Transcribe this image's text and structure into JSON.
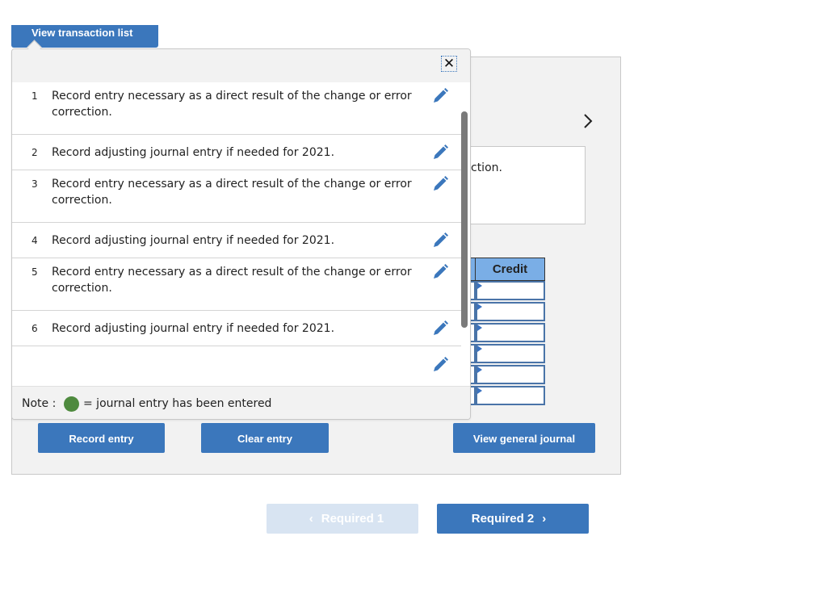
{
  "tab": {
    "view_transaction_list": "View transaction list"
  },
  "popover": {
    "close_label": "✕",
    "transactions": [
      {
        "number": "1",
        "text": "Record entry necessary as a direct result of the change or error correction."
      },
      {
        "number": "2",
        "text": "Record adjusting journal entry if needed for 2021."
      },
      {
        "number": "3",
        "text": "Record entry necessary as a direct result of the change or error correction."
      },
      {
        "number": "4",
        "text": "Record adjusting journal entry if needed for 2021."
      },
      {
        "number": "5",
        "text": "Record entry necessary as a direct result of the change or error correction."
      },
      {
        "number": "6",
        "text": "Record adjusting journal entry if needed for 2021."
      }
    ],
    "note": {
      "label": "Note :",
      "text": "= journal entry has been entered",
      "dot_color": "#4e8a3e"
    }
  },
  "worksheet": {
    "next_arrow": "›",
    "description_fragment": "ction.",
    "credit_header": "Credit",
    "credit_rows": [
      "",
      "",
      "",
      "",
      "",
      ""
    ]
  },
  "buttons": {
    "record_entry": "Record entry",
    "clear_entry": "Clear entry",
    "view_general_journal": "View general journal"
  },
  "navigation": {
    "prev_label": "Required 1",
    "next_label": "Required 2",
    "prev_chevron": "‹",
    "next_chevron": "›"
  },
  "colors": {
    "primary": "#3b77bc",
    "disabled": "#d8e4f2",
    "header_blue": "#7aaee6"
  }
}
